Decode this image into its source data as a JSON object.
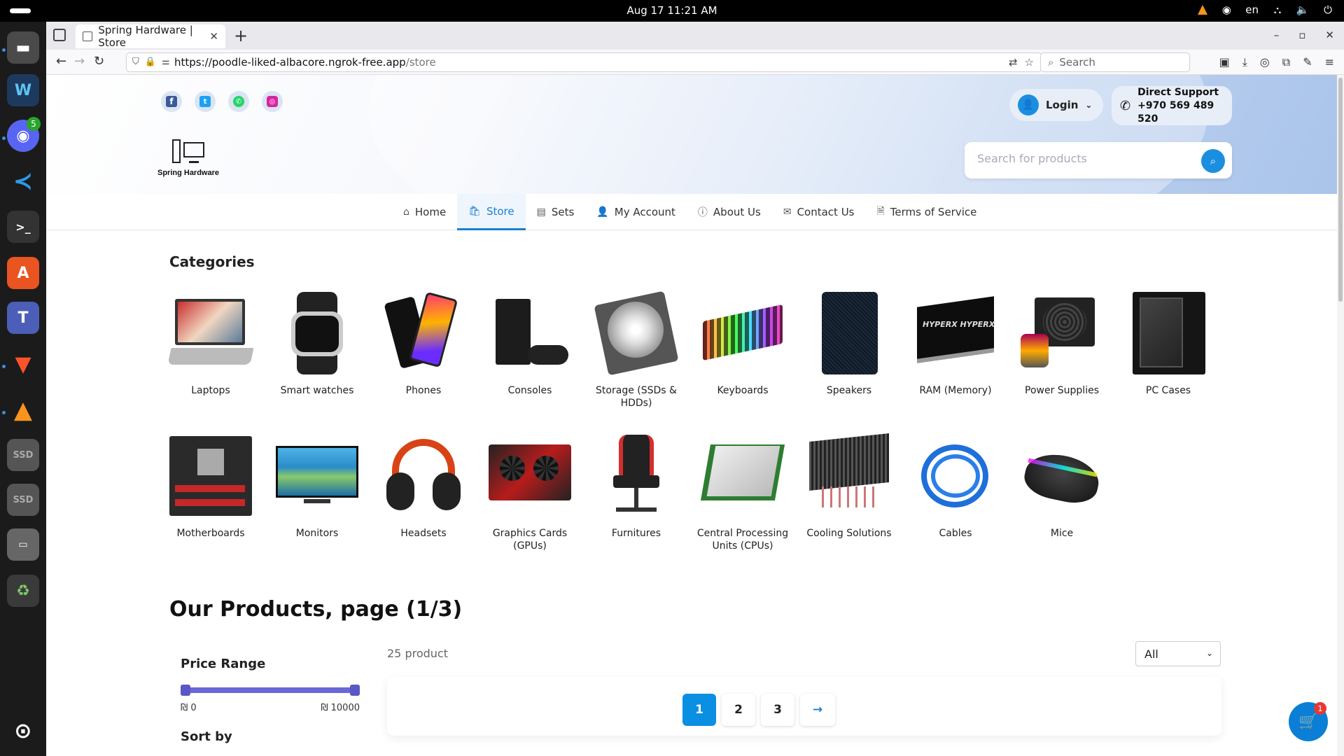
{
  "system": {
    "clock": "Aug 17  11:21 AM",
    "lang": "en"
  },
  "dock": {
    "discord_badge": "5"
  },
  "browser": {
    "tab_title": "Spring Hardware | Store",
    "url_host": "https://poodle-liked-albacore.ngrok-free.app",
    "url_path": "/store",
    "search_placeholder": "Search"
  },
  "header": {
    "login_label": "Login",
    "support_title": "Direct Support",
    "support_phone": "+970 569 489 520",
    "search_placeholder": "Search for products",
    "logo_text": "Spring Hardware"
  },
  "nav": {
    "items": [
      {
        "label": "Home",
        "icon": "home-icon"
      },
      {
        "label": "Store",
        "icon": "shopping-bag-icon"
      },
      {
        "label": "Sets",
        "icon": "receipt-icon"
      },
      {
        "label": "My Account",
        "icon": "user-icon"
      },
      {
        "label": "About Us",
        "icon": "info-icon"
      },
      {
        "label": "Contact Us",
        "icon": "mail-icon"
      },
      {
        "label": "Terms of Service",
        "icon": "document-icon"
      }
    ],
    "active_index": 1
  },
  "categories": {
    "title": "Categories",
    "items": [
      "Laptops",
      "Smart watches",
      "Phones",
      "Consoles",
      "Storage (SSDs & HDDs)",
      "Keyboards",
      "Speakers",
      "RAM (Memory)",
      "Power Supplies",
      "PC Cases",
      "Motherboards",
      "Monitors",
      "Headsets",
      "Graphics Cards (GPUs)",
      "Furnitures",
      "Central Processing Units (CPUs)",
      "Cooling Solutions",
      "Cables",
      "Mice"
    ]
  },
  "products": {
    "title": "Our Products, page (1/3)",
    "count": "25 product",
    "filter_select": "All",
    "price_range_title": "Price Range",
    "price_min": "₪ 0",
    "price_max": "₪ 10000",
    "sort_title": "Sort by",
    "pages": [
      "1",
      "2",
      "3"
    ],
    "current_page": "1",
    "prev_arrow": "←",
    "next_arrow": "→"
  },
  "cart": {
    "count": "1"
  }
}
